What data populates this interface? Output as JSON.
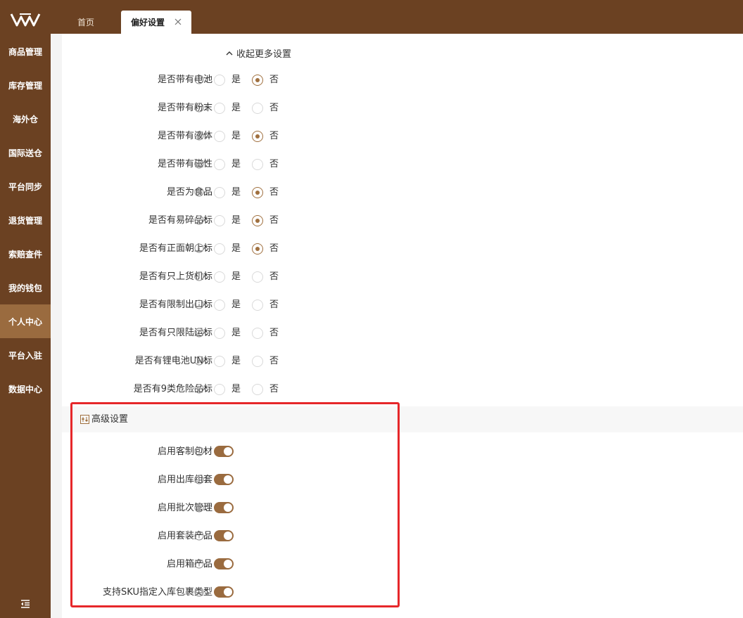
{
  "sidebar": {
    "logo": "logo-icon",
    "items": [
      {
        "label": "商品管理"
      },
      {
        "label": "库存管理"
      },
      {
        "label": "海外仓"
      },
      {
        "label": "国际送仓"
      },
      {
        "label": "平台同步"
      },
      {
        "label": "退货管理"
      },
      {
        "label": "索赔查件"
      },
      {
        "label": "我的钱包"
      },
      {
        "label": "个人中心",
        "active": true
      },
      {
        "label": "平台入驻"
      },
      {
        "label": "数据中心"
      }
    ],
    "collapse_icon": "menu-fold-icon"
  },
  "tabs": [
    {
      "label": "首页"
    },
    {
      "label": "偏好设置",
      "active": true,
      "closable": true
    }
  ],
  "collapse_more": "收起更多设置",
  "options": {
    "yes": "是",
    "no": "否"
  },
  "settings": [
    {
      "label": "是否带有电池",
      "value": "否"
    },
    {
      "label": "是否带有粉末",
      "value": null
    },
    {
      "label": "是否带有液体",
      "value": "否"
    },
    {
      "label": "是否带有磁性",
      "value": null
    },
    {
      "label": "是否为食品",
      "value": "否"
    },
    {
      "label": "是否有易碎品标",
      "value": "否"
    },
    {
      "label": "是否有正面朝上标",
      "value": "否"
    },
    {
      "label": "是否有只上货机标",
      "value": null
    },
    {
      "label": "是否有限制出口标",
      "value": null
    },
    {
      "label": "是否有只限陆运标",
      "value": null
    },
    {
      "label": "是否有锂电池UN标",
      "value": null
    },
    {
      "label": "是否有9类危险品标",
      "value": null
    }
  ],
  "advanced": {
    "title": "高级设置",
    "items": [
      {
        "label": "启用客制包材",
        "on": true
      },
      {
        "label": "启用出库组套",
        "on": true
      },
      {
        "label": "启用批次管理",
        "on": true
      },
      {
        "label": "启用套装产品",
        "on": true
      },
      {
        "label": "启用箱产品",
        "on": true
      },
      {
        "label": "支持SKU指定入库包裹类型",
        "on": true
      }
    ]
  },
  "colors": {
    "sidebar": "#6b4122",
    "accent": "#9a6b3f",
    "highlight": "#e6272a"
  }
}
